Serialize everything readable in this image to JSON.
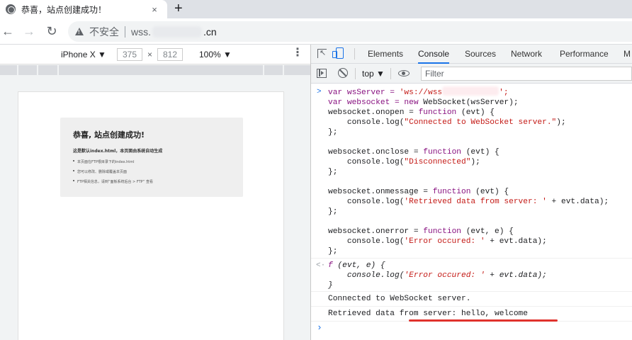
{
  "browser": {
    "tab_title": "恭喜，站点创建成功！",
    "tab_close": "×",
    "new_tab": "+",
    "back": "←",
    "forward": "→",
    "reload": "↻",
    "security_label": "不安全",
    "url_start": "wss.",
    "url_end": ".cn"
  },
  "device_toolbar": {
    "device": "iPhone X ▼",
    "width": "375",
    "height": "812",
    "times": "×",
    "zoom": "100% ▼",
    "more": "⋮"
  },
  "page": {
    "title": "恭喜, 站点创建成功!",
    "subtitle": "这是默认index.html，本页面由系统自动生成",
    "items": [
      "本页面在FTP根目录下的index.html",
      "您可以修改、删除或覆盖本页面",
      "FTP相关信息，请到“面板系统后台 > FTP” 查看"
    ]
  },
  "devtools": {
    "tabs": [
      "Elements",
      "Console",
      "Sources",
      "Network",
      "Performance",
      "M"
    ],
    "active_tab": "Console",
    "context": "top ▼",
    "filter_placeholder": "Filter"
  },
  "console": {
    "prompt_symbol": ">",
    "result_symbol": "<·",
    "code_line1_a": "var wsServer = ",
    "code_line1_str_a": "'ws://wss",
    "code_line1_str_b": "';",
    "code_line2_a": "var websocket = ",
    "code_line2_kw": "new",
    "code_line2_b": " WebSocket(wsServer);",
    "onopen_a": "websocket.onopen = ",
    "onopen_b": " (evt) {",
    "onopen_log_a": "    console.log(",
    "onopen_log_str": "\"Connected to WebSocket server.\"",
    "onopen_log_b": ");",
    "close_brace": "};",
    "onclose_a": "websocket.onclose = ",
    "onclose_b": " (evt) {",
    "onclose_log_a": "    console.log(",
    "onclose_log_str": "\"Disconnected\"",
    "onclose_log_b": ");",
    "onmessage_a": "websocket.onmessage = ",
    "onmessage_b": " (evt) {",
    "onmessage_log_a": "    console.log(",
    "onmessage_log_str": "'Retrieved data from server: '",
    "onmessage_log_b": " + evt.data);",
    "onerror_a": "websocket.onerror = ",
    "onerror_b": " (evt, e) {",
    "onerror_log_a": "    console.log(",
    "onerror_log_str": "'Error occured: '",
    "onerror_log_b": " + evt.data);",
    "function_kw": "function",
    "result_f": "f",
    "result_sig": " (evt, e) {",
    "result_body_a": "    console.log(",
    "result_body_str": "'Error occured: '",
    "result_body_b": " + evt.data);",
    "result_end": "}",
    "log1": "Connected to WebSocket server.",
    "log2": "Retrieved data from server: hello, welcome",
    "input_prompt": "›"
  }
}
